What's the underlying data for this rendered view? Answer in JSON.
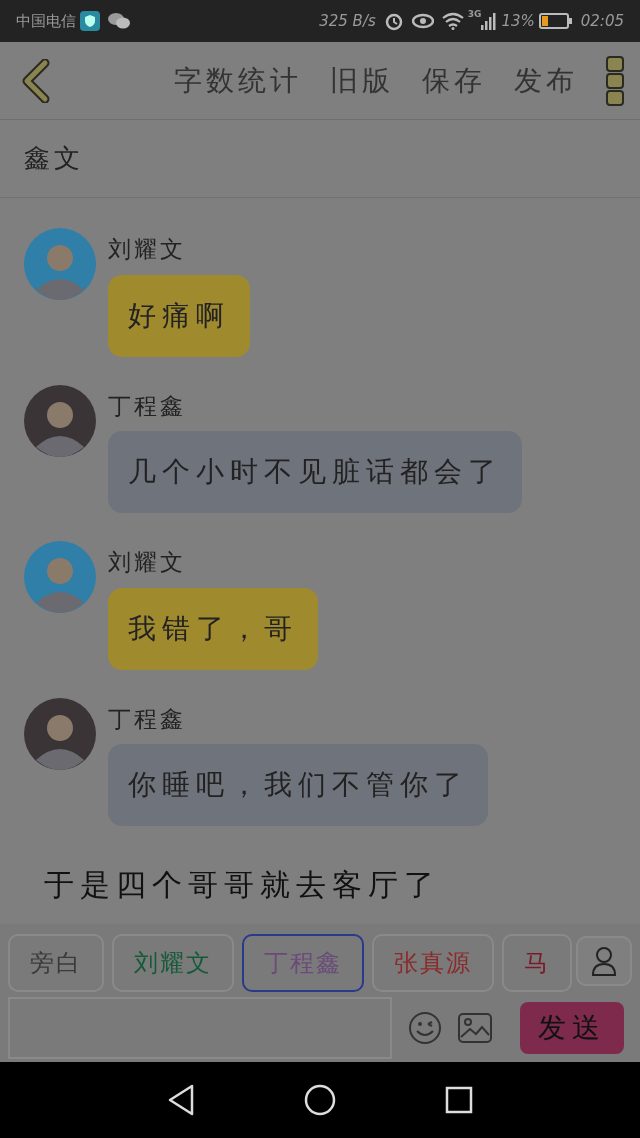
{
  "status_bar": {
    "carrier": "中国电信",
    "speed": "325 B/s",
    "network": "3G",
    "battery": "13%",
    "time": "02:05"
  },
  "toolbar": {
    "actions": [
      "字数统计",
      "旧版",
      "保存",
      "发布"
    ]
  },
  "story_title": "鑫文",
  "messages": [
    {
      "kind": "message",
      "speaker": "刘耀文",
      "text": "好痛啊",
      "color": "#a08a2e",
      "avatar": {
        "color": "#2f7fa8"
      }
    },
    {
      "kind": "message",
      "speaker": "丁程鑫",
      "text": "几个小时不见脏话都会了",
      "color": "#6f747c",
      "avatar": {
        "color": "#3a3436"
      }
    },
    {
      "kind": "message",
      "speaker": "刘耀文",
      "text": "我错了，哥",
      "color": "#a08a2e",
      "avatar": {
        "color": "#2f7fa8"
      }
    },
    {
      "kind": "message",
      "speaker": "丁程鑫",
      "text": "你睡吧，我们不管你了",
      "color": "#6f747c",
      "avatar": {
        "color": "#3a3436"
      }
    },
    {
      "kind": "narration",
      "text": "于是四个哥哥就去客厅了"
    }
  ],
  "speakers": [
    {
      "label": "旁白",
      "color": "#3a3a3a",
      "selected": false
    },
    {
      "label": "刘耀文",
      "color": "#155a3a",
      "selected": false
    },
    {
      "label": "丁程鑫",
      "color": "#6a4a7a",
      "selected": true
    },
    {
      "label": "张真源",
      "color": "#8a2a2a",
      "selected": false
    },
    {
      "label": "马",
      "color": "#7a1a2a",
      "selected": false
    }
  ],
  "composer": {
    "send": "发送"
  }
}
